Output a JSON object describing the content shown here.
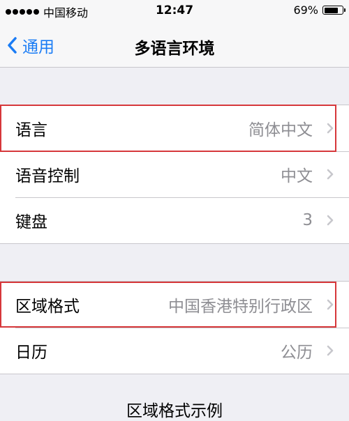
{
  "status_bar": {
    "carrier": "中国移动",
    "time": "12:47",
    "battery": "69%",
    "battery_level": 0.69
  },
  "nav": {
    "back_label": "通用",
    "title": "多语言环境"
  },
  "group1": [
    {
      "label": "语言",
      "value": "简体中文"
    },
    {
      "label": "语音控制",
      "value": "中文"
    },
    {
      "label": "键盘",
      "value": "3"
    }
  ],
  "group2": [
    {
      "label": "区域格式",
      "value": "中国香港特别行政区"
    },
    {
      "label": "日历",
      "value": "公历"
    }
  ],
  "footer": {
    "text": "区域格式示例"
  },
  "colors": {
    "accent": "#1a7cf5",
    "highlight": "#d6373a",
    "secondary_text": "#8e8e93"
  }
}
